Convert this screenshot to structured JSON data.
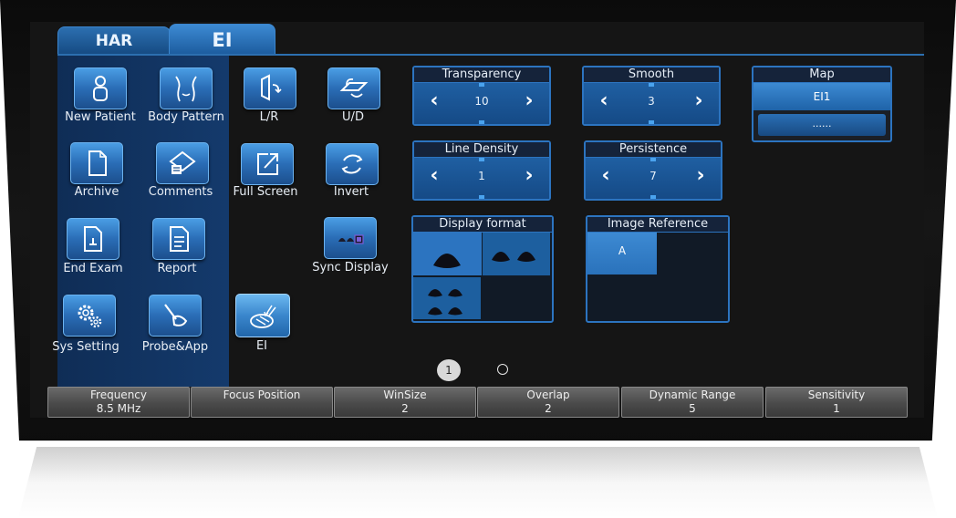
{
  "tabs": [
    {
      "label": "HAR",
      "active": false
    },
    {
      "label": "EI",
      "active": true
    }
  ],
  "left_panel": [
    {
      "label": "New Patient",
      "icon": "person-icon"
    },
    {
      "label": "Body Pattern",
      "icon": "body-pattern-icon"
    },
    {
      "label": "Archive",
      "icon": "document-icon"
    },
    {
      "label": "Comments",
      "icon": "comments-icon"
    },
    {
      "label": "End Exam",
      "icon": "end-exam-icon"
    },
    {
      "label": "Report",
      "icon": "report-icon"
    },
    {
      "label": "Sys Setting",
      "icon": "gears-icon"
    },
    {
      "label": "Probe&App",
      "icon": "probe-icon"
    }
  ],
  "image_buttons": {
    "lr": "L/R",
    "ud": "U/D",
    "full_screen": "Full Screen",
    "invert": "Invert",
    "sync_display": "Sync Display",
    "ei": "EI"
  },
  "controls": {
    "transparency": {
      "title": "Transparency",
      "value": "10"
    },
    "smooth": {
      "title": "Smooth",
      "value": "3"
    },
    "line_density": {
      "title": "Line Density",
      "value": "1"
    },
    "persistence": {
      "title": "Persistence",
      "value": "7"
    }
  },
  "map": {
    "title": "Map",
    "selected": "EI1",
    "other": "......"
  },
  "display_format": {
    "title": "Display format"
  },
  "image_reference": {
    "title": "Image Reference",
    "selected": "A"
  },
  "pagination": {
    "current": "1"
  },
  "bottom_bar": [
    {
      "label": "Frequency",
      "value": "8.5 MHz"
    },
    {
      "label": "Focus Position",
      "value": ""
    },
    {
      "label": "WinSize",
      "value": "2"
    },
    {
      "label": "Overlap",
      "value": "2"
    },
    {
      "label": "Dynamic Range",
      "value": "5"
    },
    {
      "label": "Sensitivity",
      "value": "1"
    }
  ],
  "colors": {
    "accent": "#2c74c0",
    "panel": "#143a6c",
    "bezel": "#111111"
  }
}
